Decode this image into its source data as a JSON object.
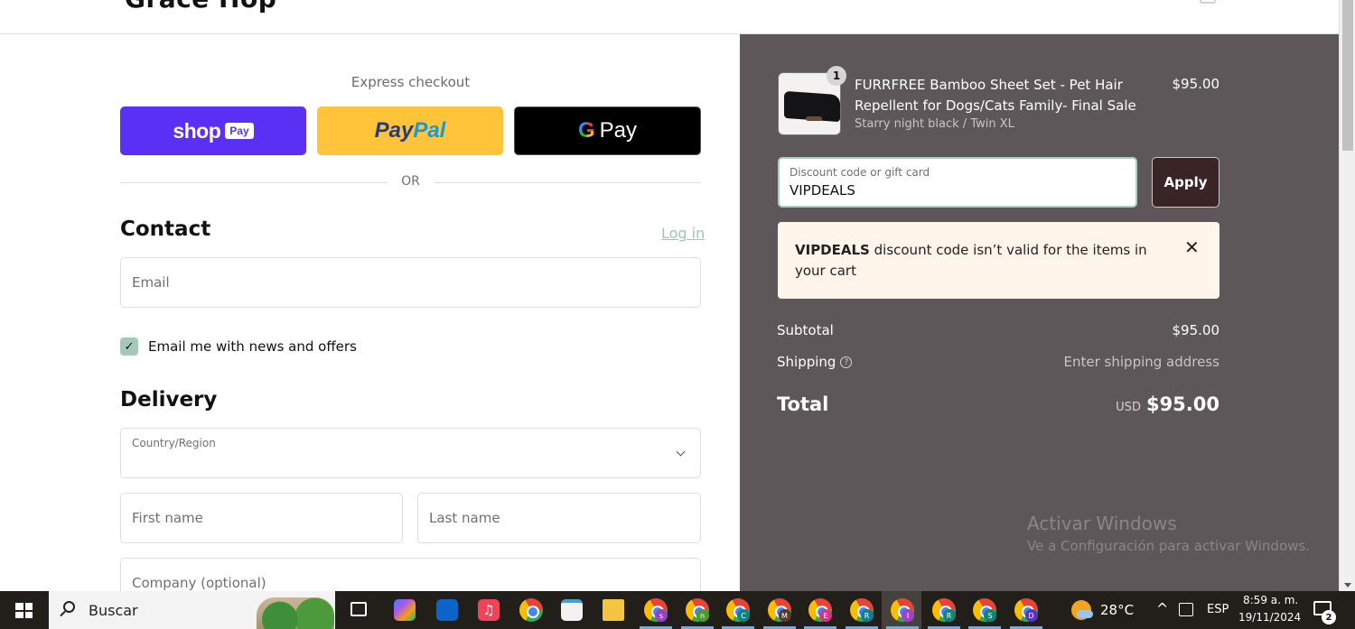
{
  "header": {
    "logo_text": "Grace Hop"
  },
  "express": {
    "title": "Express checkout",
    "shop_pay": {
      "word": "shop",
      "badge": "Pay"
    },
    "paypal": {
      "part1": "Pay",
      "part2": "Pal"
    },
    "gpay": {
      "g": "G",
      "label": "Pay"
    },
    "or_label": "OR"
  },
  "contact": {
    "title": "Contact",
    "login_link": "Log in",
    "email_placeholder": "Email",
    "newsletter_label": "Email me with news and offers",
    "newsletter_checked": true
  },
  "delivery": {
    "title": "Delivery",
    "country_label": "Country/Region",
    "country_value": "",
    "first_name_placeholder": "First name",
    "last_name_placeholder": "Last name",
    "company_placeholder": "Company (optional)"
  },
  "summary": {
    "product": {
      "quantity": "1",
      "name": "FURRFREE Bamboo Sheet Set - Pet Hair Repellent for Dogs/Cats Family- Final Sale",
      "variant": "Starry night black / Twin XL",
      "price": "$95.00"
    },
    "discount": {
      "label": "Discount code or gift card",
      "value": "VIPDEALS",
      "apply_label": "Apply"
    },
    "error": {
      "code": "VIPDEALS",
      "message": " discount code isn’t valid for the items in your cart",
      "close_glyph": "✕"
    },
    "subtotal_label": "Subtotal",
    "subtotal_value": "$95.00",
    "shipping_label": "Shipping",
    "shipping_value": "Enter shipping address",
    "help_glyph": "?",
    "total_label": "Total",
    "total_currency": "USD",
    "total_value": "$95.00"
  },
  "watermark": {
    "line1": "Activar Windows",
    "line2": "Ve a Configuración para activar Windows."
  },
  "taskbar": {
    "search_label": "Buscar",
    "chrome_profiles": [
      {
        "letter": "s",
        "color": "#9b3fc4"
      },
      {
        "letter": "n",
        "color": "#4d9a2a"
      },
      {
        "letter": "C",
        "color": "#11847a"
      },
      {
        "letter": "M",
        "color": "#5b3a2e"
      },
      {
        "letter": "E",
        "color": "#d63384"
      },
      {
        "letter": "R",
        "color": "#137e8c"
      },
      {
        "letter": "I",
        "color": "#a241c6"
      },
      {
        "letter": "R",
        "color": "#11847a"
      },
      {
        "letter": "S",
        "color": "#11847a"
      },
      {
        "letter": "D",
        "color": "#5a35b8"
      }
    ],
    "temperature": "28°C",
    "language": "ESP",
    "time": "8:59 a. m.",
    "date": "19/11/2024",
    "notification_count": "2"
  }
}
